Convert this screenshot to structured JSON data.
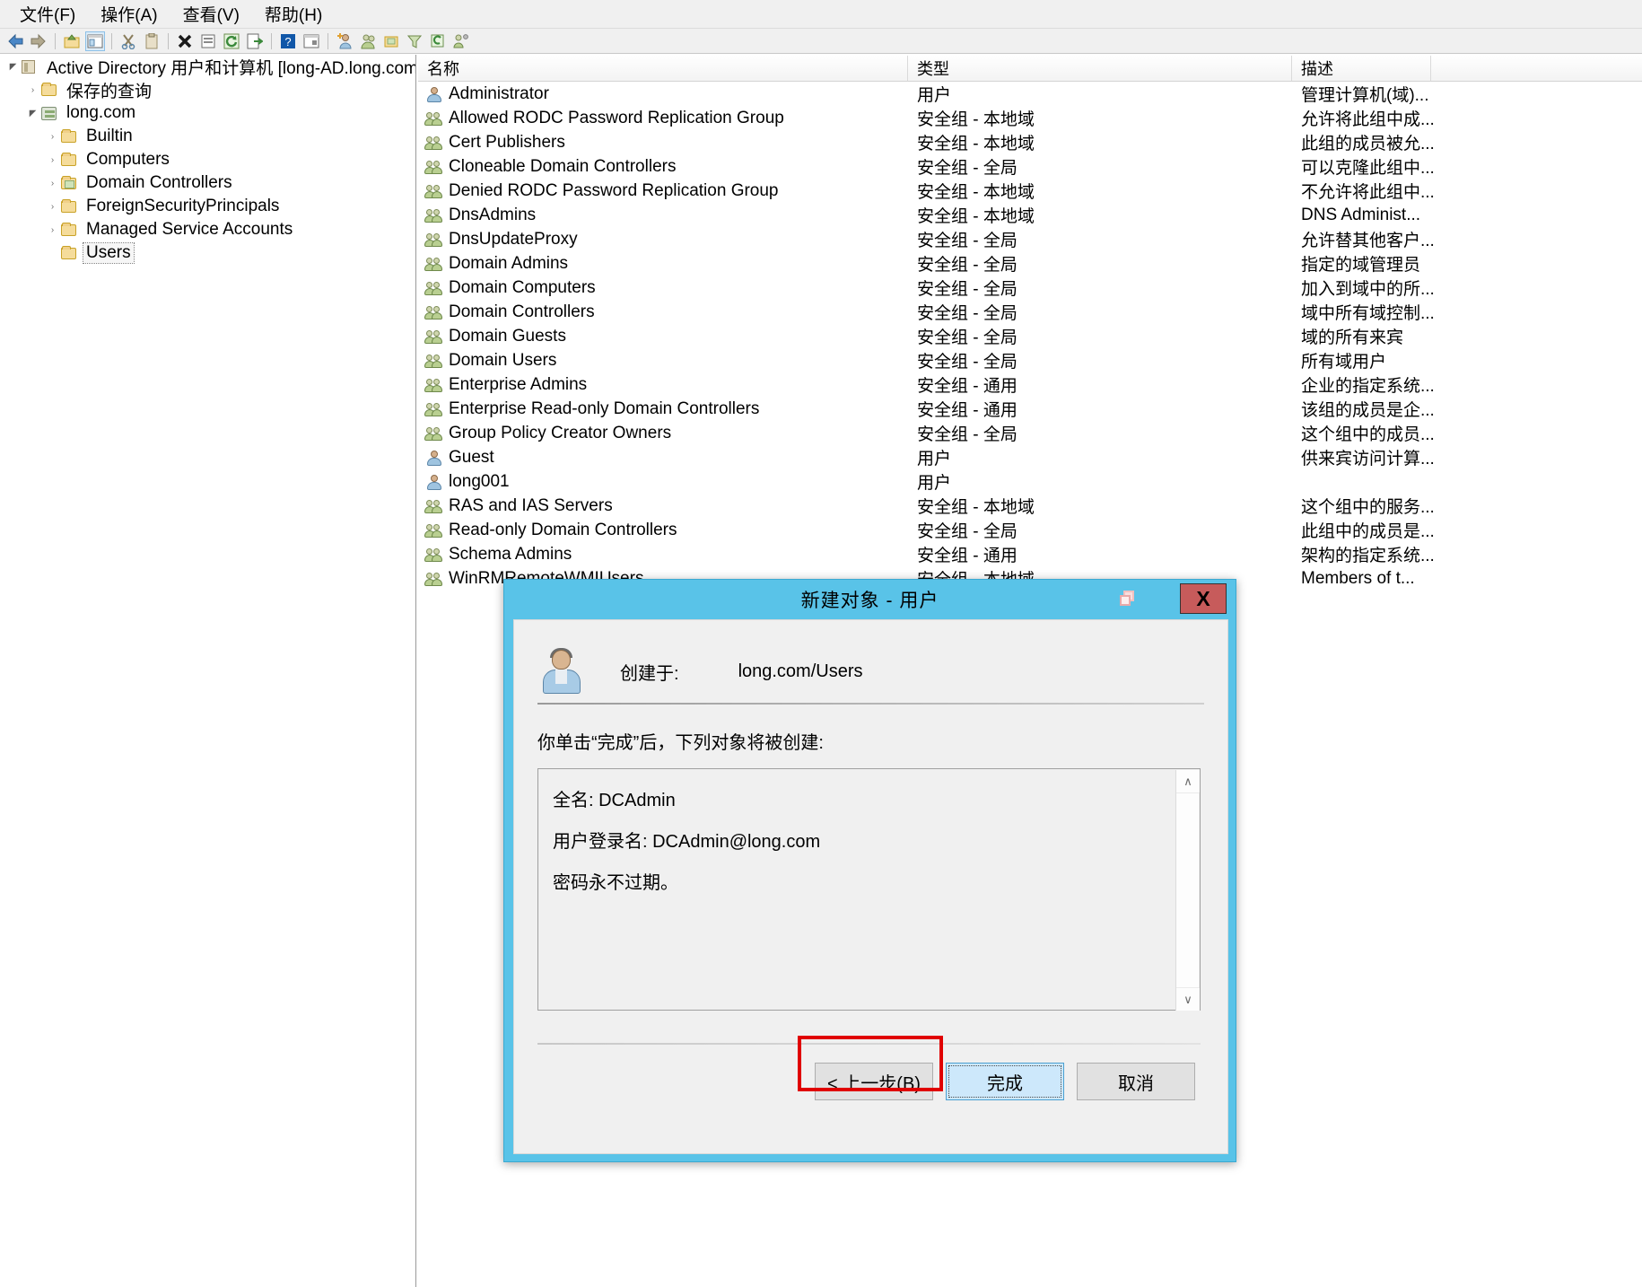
{
  "menubar": {
    "items": [
      {
        "label": "文件(F)",
        "name": "menu-file"
      },
      {
        "label": "操作(A)",
        "name": "menu-action"
      },
      {
        "label": "查看(V)",
        "name": "menu-view"
      },
      {
        "label": "帮助(H)",
        "name": "menu-help"
      }
    ]
  },
  "toolbar": {
    "buttons": [
      "back-icon",
      "forward-icon",
      "sep",
      "up-folder-icon",
      "show-hide-tree-icon",
      "sep",
      "cut-icon",
      "copy-icon",
      "sep",
      "delete-icon",
      "properties-icon",
      "refresh-icon",
      "export-list-icon",
      "sep",
      "help-icon",
      "show-console-tree-icon",
      "sep",
      "new-user-icon",
      "new-group-icon",
      "new-ou-icon",
      "filter-icon",
      "find-icon",
      "advanced-features-icon"
    ]
  },
  "tree": {
    "nodes": [
      {
        "label": "Active Directory 用户和计算机 [long-AD.long.com]",
        "icon": "console-root-icon",
        "indent": 0,
        "twisty": "expanded",
        "selected": false
      },
      {
        "label": "保存的查询",
        "icon": "folder-icon",
        "indent": 1,
        "twisty": "collapsed",
        "selected": false
      },
      {
        "label": "long.com",
        "icon": "domain-icon",
        "indent": 1,
        "twisty": "expanded",
        "selected": false
      },
      {
        "label": "Builtin",
        "icon": "folder-icon",
        "indent": 2,
        "twisty": "collapsed",
        "selected": false
      },
      {
        "label": "Computers",
        "icon": "folder-icon",
        "indent": 2,
        "twisty": "collapsed",
        "selected": false
      },
      {
        "label": "Domain Controllers",
        "icon": "folder-special-icon",
        "indent": 2,
        "twisty": "collapsed",
        "selected": false
      },
      {
        "label": "ForeignSecurityPrincipals",
        "icon": "folder-icon",
        "indent": 2,
        "twisty": "collapsed",
        "selected": false
      },
      {
        "label": "Managed Service Accounts",
        "icon": "folder-icon",
        "indent": 2,
        "twisty": "collapsed",
        "selected": false
      },
      {
        "label": "Users",
        "icon": "folder-icon",
        "indent": 2,
        "twisty": "none",
        "selected": true
      }
    ]
  },
  "list": {
    "columns": [
      {
        "label": "名称",
        "name": "column-name"
      },
      {
        "label": "类型",
        "name": "column-type"
      },
      {
        "label": "描述",
        "name": "column-description"
      }
    ],
    "rows": [
      {
        "name": "Administrator",
        "type": "用户",
        "desc": "管理计算机(域)...",
        "icon": "user-icon"
      },
      {
        "name": "Allowed RODC Password Replication Group",
        "type": "安全组 - 本地域",
        "desc": "允许将此组中成...",
        "icon": "group-icon"
      },
      {
        "name": "Cert Publishers",
        "type": "安全组 - 本地域",
        "desc": "此组的成员被允...",
        "icon": "group-icon"
      },
      {
        "name": "Cloneable Domain Controllers",
        "type": "安全组 - 全局",
        "desc": "可以克隆此组中...",
        "icon": "group-icon"
      },
      {
        "name": "Denied RODC Password Replication Group",
        "type": "安全组 - 本地域",
        "desc": "不允许将此组中...",
        "icon": "group-icon"
      },
      {
        "name": "DnsAdmins",
        "type": "安全组 - 本地域",
        "desc": "DNS Administ...",
        "icon": "group-icon"
      },
      {
        "name": "DnsUpdateProxy",
        "type": "安全组 - 全局",
        "desc": "允许替其他客户...",
        "icon": "group-icon"
      },
      {
        "name": "Domain Admins",
        "type": "安全组 - 全局",
        "desc": "指定的域管理员",
        "icon": "group-icon"
      },
      {
        "name": "Domain Computers",
        "type": "安全组 - 全局",
        "desc": "加入到域中的所...",
        "icon": "group-icon"
      },
      {
        "name": "Domain Controllers",
        "type": "安全组 - 全局",
        "desc": "域中所有域控制...",
        "icon": "group-icon"
      },
      {
        "name": "Domain Guests",
        "type": "安全组 - 全局",
        "desc": "域的所有来宾",
        "icon": "group-icon"
      },
      {
        "name": "Domain Users",
        "type": "安全组 - 全局",
        "desc": "所有域用户",
        "icon": "group-icon"
      },
      {
        "name": "Enterprise Admins",
        "type": "安全组 - 通用",
        "desc": "企业的指定系统...",
        "icon": "group-icon"
      },
      {
        "name": "Enterprise Read-only Domain Controllers",
        "type": "安全组 - 通用",
        "desc": "该组的成员是企...",
        "icon": "group-icon"
      },
      {
        "name": "Group Policy Creator Owners",
        "type": "安全组 - 全局",
        "desc": "这个组中的成员...",
        "icon": "group-icon"
      },
      {
        "name": "Guest",
        "type": "用户",
        "desc": "供来宾访问计算...",
        "icon": "user-icon"
      },
      {
        "name": "long001",
        "type": "用户",
        "desc": "",
        "icon": "user-icon"
      },
      {
        "name": "RAS and IAS Servers",
        "type": "安全组 - 本地域",
        "desc": "这个组中的服务...",
        "icon": "group-icon"
      },
      {
        "name": "Read-only Domain Controllers",
        "type": "安全组 - 全局",
        "desc": "此组中的成员是...",
        "icon": "group-icon"
      },
      {
        "name": "Schema Admins",
        "type": "安全组 - 通用",
        "desc": "架构的指定系统...",
        "icon": "group-icon"
      },
      {
        "name": "WinRMRemoteWMIUsers__",
        "type": "安全组 - 本地域",
        "desc": "Members of t...",
        "icon": "group-icon"
      }
    ]
  },
  "dialog": {
    "title": "新建对象 - 用户",
    "restore_label": "",
    "close_label": "X",
    "created_in_label": "创建于:",
    "created_in_value": "long.com/Users",
    "question": "你单击“完成”后，下列对象将被创建:",
    "summary_lines": [
      "全名: DCAdmin",
      "用户登录名: DCAdmin@long.com",
      "密码永不过期。"
    ],
    "scroll_up": "∧",
    "scroll_down": "∨",
    "buttons": {
      "back": "< 上一步(B)",
      "finish": "完成",
      "cancel": "取消"
    }
  },
  "colors": {
    "dialog_frame": "#59c3e8",
    "annotation": "#e00000",
    "default_button": "#cde8fb",
    "close_button": "#c75b5b"
  }
}
